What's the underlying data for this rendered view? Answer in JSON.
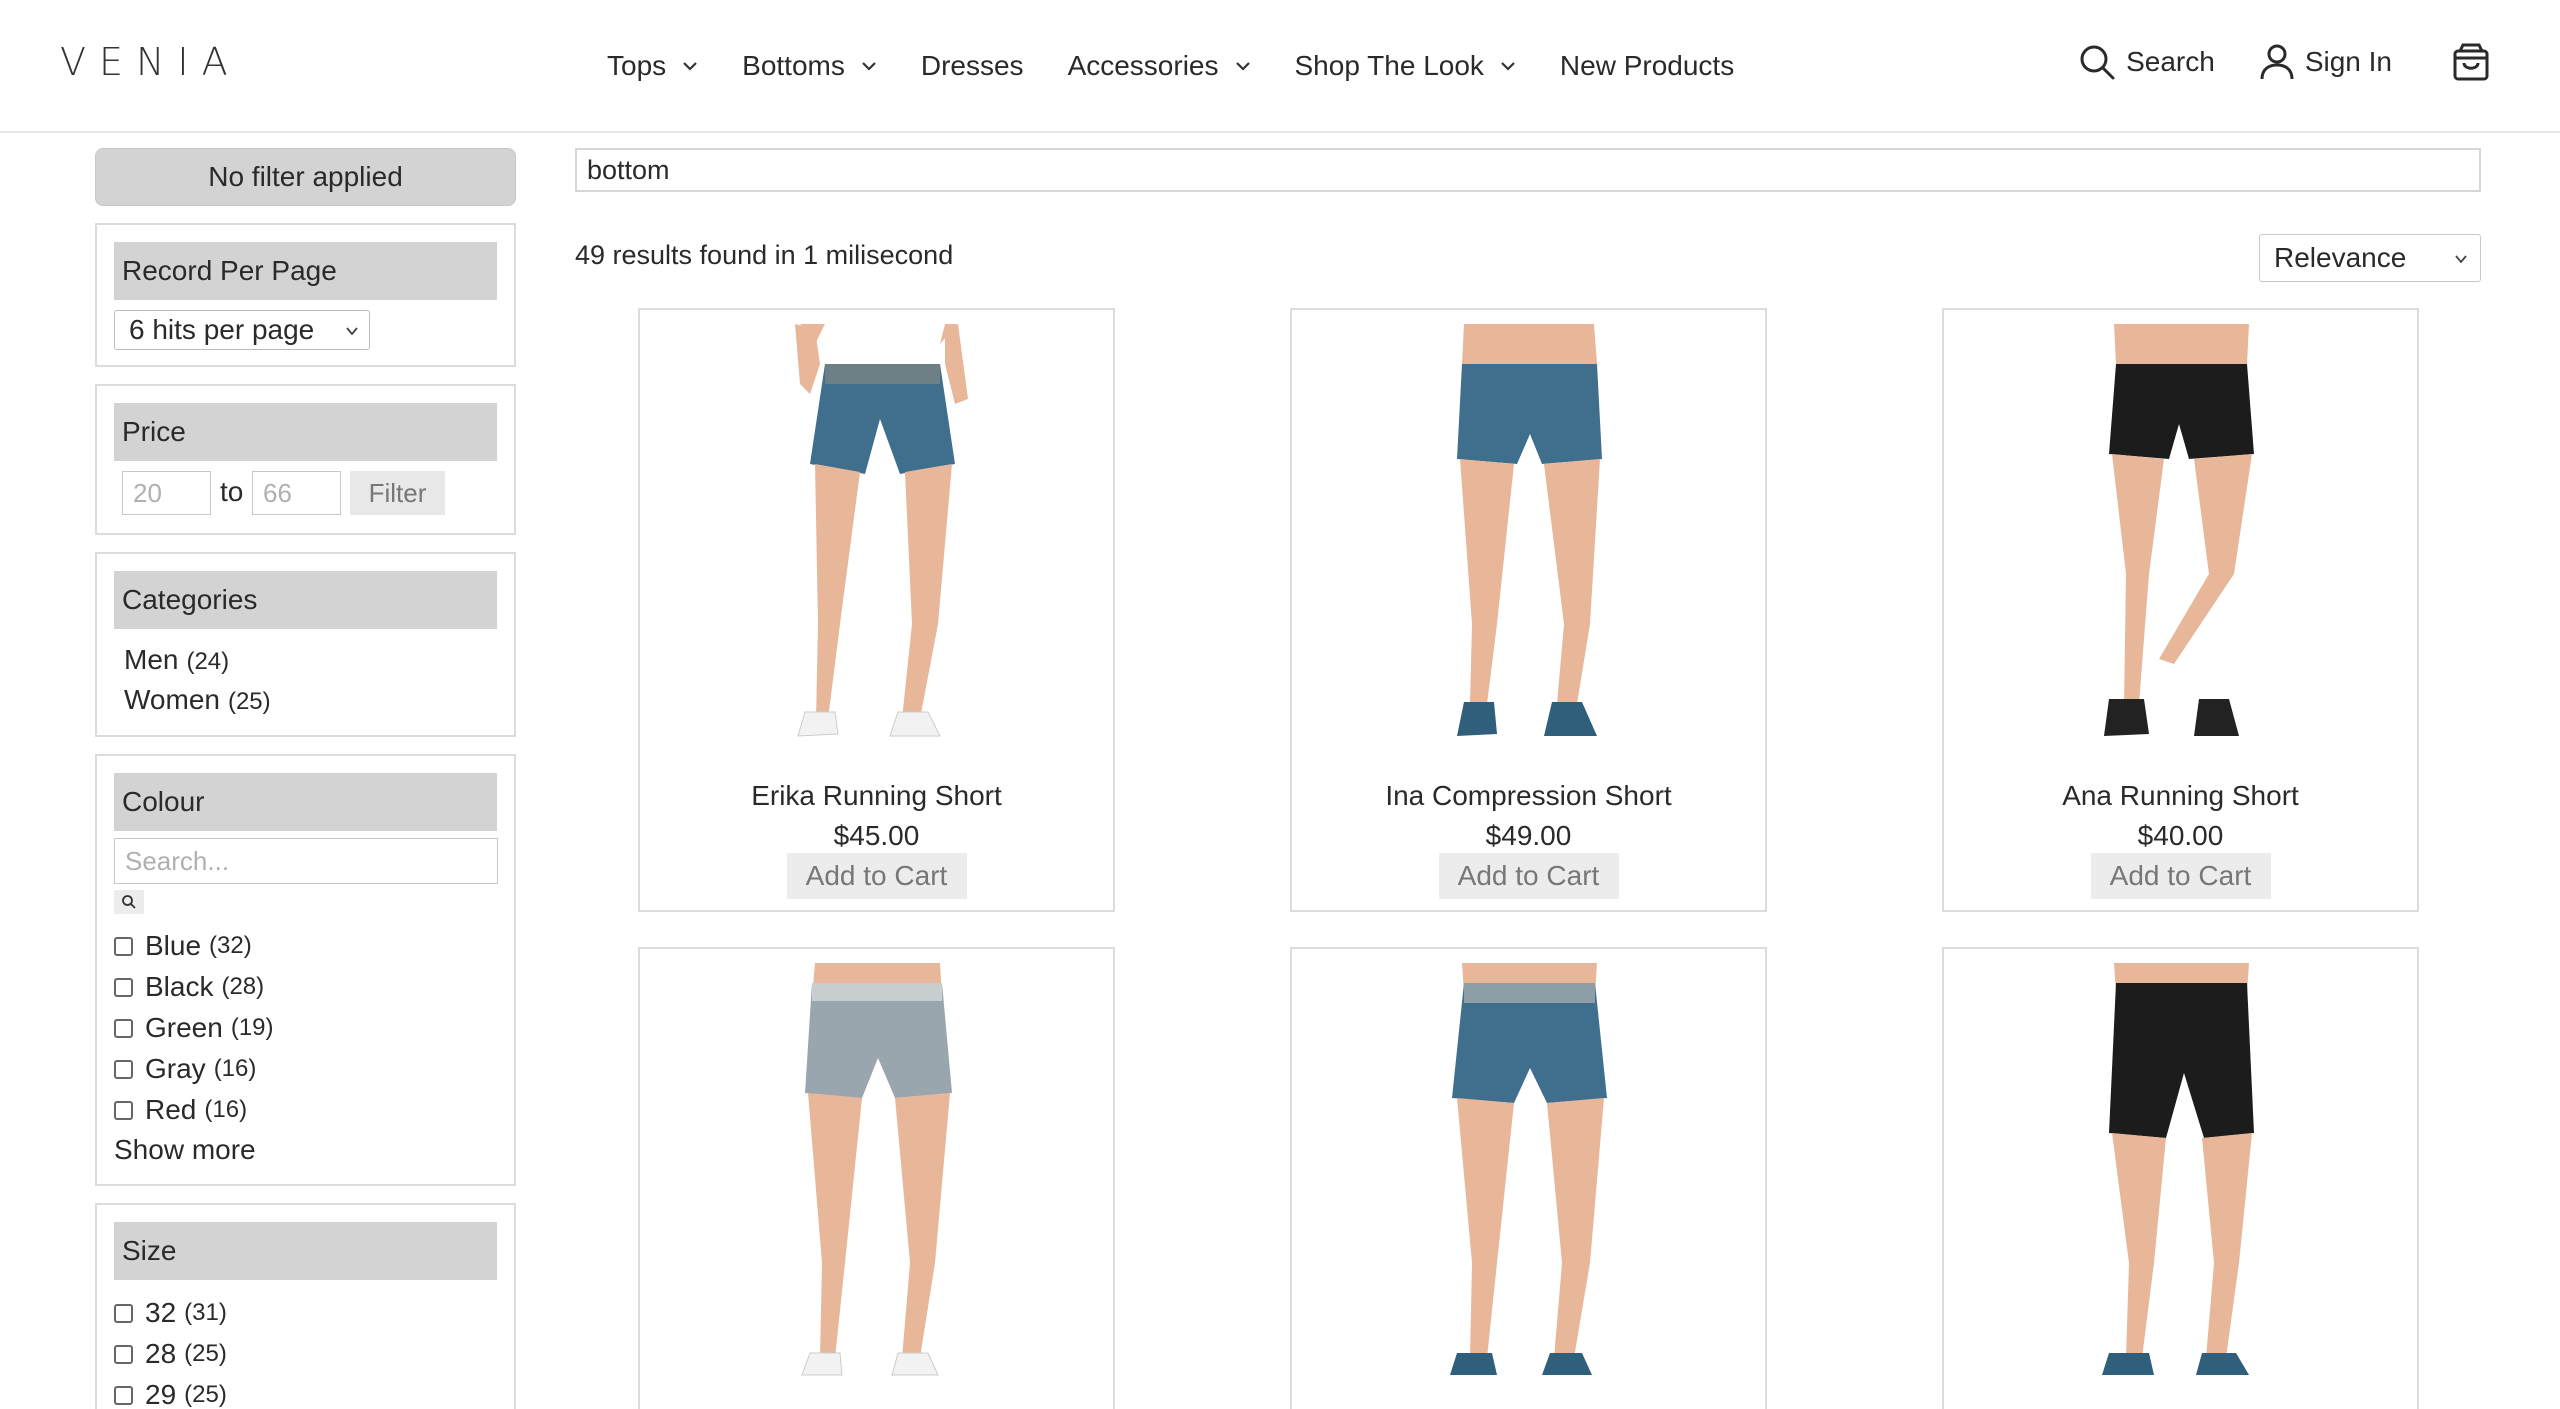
{
  "header": {
    "logo": "VENIA",
    "nav": [
      {
        "label": "Tops",
        "dropdown": true
      },
      {
        "label": "Bottoms",
        "dropdown": true
      },
      {
        "label": "Dresses",
        "dropdown": false
      },
      {
        "label": "Accessories",
        "dropdown": true
      },
      {
        "label": "Shop The Look",
        "dropdown": true
      },
      {
        "label": "New Products",
        "dropdown": false
      }
    ],
    "search_label": "Search",
    "signin_label": "Sign In",
    "icons": {
      "search": "search-icon",
      "user": "user-icon",
      "cart": "shopping-bag-icon"
    }
  },
  "sidebar": {
    "no_filter": "No filter applied",
    "record_per_page": {
      "title": "Record Per Page",
      "selected": "6 hits per page"
    },
    "price": {
      "title": "Price",
      "min_placeholder": "20",
      "to": "to",
      "max_placeholder": "66",
      "filter_label": "Filter"
    },
    "categories": {
      "title": "Categories",
      "items": [
        {
          "label": "Men",
          "count": "(24)"
        },
        {
          "label": "Women",
          "count": "(25)"
        }
      ]
    },
    "colour": {
      "title": "Colour",
      "search_placeholder": "Search...",
      "items": [
        {
          "label": "Blue",
          "count": "(32)"
        },
        {
          "label": "Black",
          "count": "(28)"
        },
        {
          "label": "Green",
          "count": "(19)"
        },
        {
          "label": "Gray",
          "count": "(16)"
        },
        {
          "label": "Red",
          "count": "(16)"
        }
      ],
      "show_more": "Show more"
    },
    "size": {
      "title": "Size",
      "items": [
        {
          "label": "32",
          "count": "(31)"
        },
        {
          "label": "28",
          "count": "(25)"
        },
        {
          "label": "29",
          "count": "(25)"
        }
      ]
    }
  },
  "main": {
    "search_value": "bottom",
    "results_text": "49 results found in 1 milisecond",
    "sort_selected": "Relevance",
    "products": [
      {
        "name": "Erika Running Short",
        "price": "$45.00",
        "cta": "Add to Cart"
      },
      {
        "name": "Ina Compression Short",
        "price": "$49.00",
        "cta": "Add to Cart"
      },
      {
        "name": "Ana Running Short",
        "price": "$40.00",
        "cta": "Add to Cart"
      },
      {
        "name": "",
        "price": "",
        "cta": ""
      },
      {
        "name": "",
        "price": "",
        "cta": ""
      },
      {
        "name": "",
        "price": "",
        "cta": ""
      }
    ]
  },
  "colors": {
    "panel_header": "#d3d3d3",
    "border": "#dcdcdc",
    "text": "#2a2a2a",
    "shorts_blue": "#3f6f8c",
    "shorts_black": "#1c1c1c",
    "shorts_gray": "#9aa6ad",
    "skin": "#e8b79a"
  }
}
